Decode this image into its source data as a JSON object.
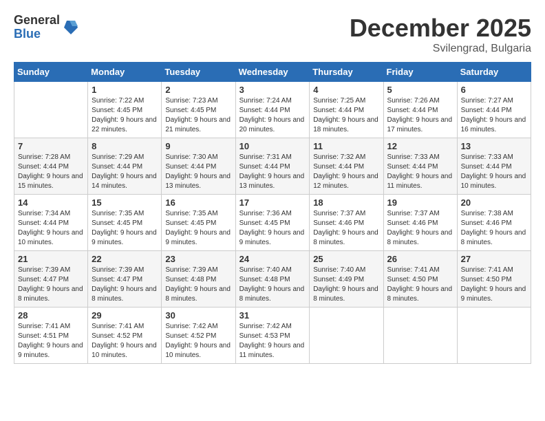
{
  "header": {
    "logo_general": "General",
    "logo_blue": "Blue",
    "month_title": "December 2025",
    "location": "Svilengrad, Bulgaria"
  },
  "days_of_week": [
    "Sunday",
    "Monday",
    "Tuesday",
    "Wednesday",
    "Thursday",
    "Friday",
    "Saturday"
  ],
  "weeks": [
    [
      {
        "day": "",
        "sunrise": "",
        "sunset": "",
        "daylight": ""
      },
      {
        "day": "1",
        "sunrise": "Sunrise: 7:22 AM",
        "sunset": "Sunset: 4:45 PM",
        "daylight": "Daylight: 9 hours and 22 minutes."
      },
      {
        "day": "2",
        "sunrise": "Sunrise: 7:23 AM",
        "sunset": "Sunset: 4:45 PM",
        "daylight": "Daylight: 9 hours and 21 minutes."
      },
      {
        "day": "3",
        "sunrise": "Sunrise: 7:24 AM",
        "sunset": "Sunset: 4:44 PM",
        "daylight": "Daylight: 9 hours and 20 minutes."
      },
      {
        "day": "4",
        "sunrise": "Sunrise: 7:25 AM",
        "sunset": "Sunset: 4:44 PM",
        "daylight": "Daylight: 9 hours and 18 minutes."
      },
      {
        "day": "5",
        "sunrise": "Sunrise: 7:26 AM",
        "sunset": "Sunset: 4:44 PM",
        "daylight": "Daylight: 9 hours and 17 minutes."
      },
      {
        "day": "6",
        "sunrise": "Sunrise: 7:27 AM",
        "sunset": "Sunset: 4:44 PM",
        "daylight": "Daylight: 9 hours and 16 minutes."
      }
    ],
    [
      {
        "day": "7",
        "sunrise": "Sunrise: 7:28 AM",
        "sunset": "Sunset: 4:44 PM",
        "daylight": "Daylight: 9 hours and 15 minutes."
      },
      {
        "day": "8",
        "sunrise": "Sunrise: 7:29 AM",
        "sunset": "Sunset: 4:44 PM",
        "daylight": "Daylight: 9 hours and 14 minutes."
      },
      {
        "day": "9",
        "sunrise": "Sunrise: 7:30 AM",
        "sunset": "Sunset: 4:44 PM",
        "daylight": "Daylight: 9 hours and 13 minutes."
      },
      {
        "day": "10",
        "sunrise": "Sunrise: 7:31 AM",
        "sunset": "Sunset: 4:44 PM",
        "daylight": "Daylight: 9 hours and 13 minutes."
      },
      {
        "day": "11",
        "sunrise": "Sunrise: 7:32 AM",
        "sunset": "Sunset: 4:44 PM",
        "daylight": "Daylight: 9 hours and 12 minutes."
      },
      {
        "day": "12",
        "sunrise": "Sunrise: 7:33 AM",
        "sunset": "Sunset: 4:44 PM",
        "daylight": "Daylight: 9 hours and 11 minutes."
      },
      {
        "day": "13",
        "sunrise": "Sunrise: 7:33 AM",
        "sunset": "Sunset: 4:44 PM",
        "daylight": "Daylight: 9 hours and 10 minutes."
      }
    ],
    [
      {
        "day": "14",
        "sunrise": "Sunrise: 7:34 AM",
        "sunset": "Sunset: 4:44 PM",
        "daylight": "Daylight: 9 hours and 10 minutes."
      },
      {
        "day": "15",
        "sunrise": "Sunrise: 7:35 AM",
        "sunset": "Sunset: 4:45 PM",
        "daylight": "Daylight: 9 hours and 9 minutes."
      },
      {
        "day": "16",
        "sunrise": "Sunrise: 7:35 AM",
        "sunset": "Sunset: 4:45 PM",
        "daylight": "Daylight: 9 hours and 9 minutes."
      },
      {
        "day": "17",
        "sunrise": "Sunrise: 7:36 AM",
        "sunset": "Sunset: 4:45 PM",
        "daylight": "Daylight: 9 hours and 9 minutes."
      },
      {
        "day": "18",
        "sunrise": "Sunrise: 7:37 AM",
        "sunset": "Sunset: 4:46 PM",
        "daylight": "Daylight: 9 hours and 8 minutes."
      },
      {
        "day": "19",
        "sunrise": "Sunrise: 7:37 AM",
        "sunset": "Sunset: 4:46 PM",
        "daylight": "Daylight: 9 hours and 8 minutes."
      },
      {
        "day": "20",
        "sunrise": "Sunrise: 7:38 AM",
        "sunset": "Sunset: 4:46 PM",
        "daylight": "Daylight: 9 hours and 8 minutes."
      }
    ],
    [
      {
        "day": "21",
        "sunrise": "Sunrise: 7:39 AM",
        "sunset": "Sunset: 4:47 PM",
        "daylight": "Daylight: 9 hours and 8 minutes."
      },
      {
        "day": "22",
        "sunrise": "Sunrise: 7:39 AM",
        "sunset": "Sunset: 4:47 PM",
        "daylight": "Daylight: 9 hours and 8 minutes."
      },
      {
        "day": "23",
        "sunrise": "Sunrise: 7:39 AM",
        "sunset": "Sunset: 4:48 PM",
        "daylight": "Daylight: 9 hours and 8 minutes."
      },
      {
        "day": "24",
        "sunrise": "Sunrise: 7:40 AM",
        "sunset": "Sunset: 4:48 PM",
        "daylight": "Daylight: 9 hours and 8 minutes."
      },
      {
        "day": "25",
        "sunrise": "Sunrise: 7:40 AM",
        "sunset": "Sunset: 4:49 PM",
        "daylight": "Daylight: 9 hours and 8 minutes."
      },
      {
        "day": "26",
        "sunrise": "Sunrise: 7:41 AM",
        "sunset": "Sunset: 4:50 PM",
        "daylight": "Daylight: 9 hours and 8 minutes."
      },
      {
        "day": "27",
        "sunrise": "Sunrise: 7:41 AM",
        "sunset": "Sunset: 4:50 PM",
        "daylight": "Daylight: 9 hours and 9 minutes."
      }
    ],
    [
      {
        "day": "28",
        "sunrise": "Sunrise: 7:41 AM",
        "sunset": "Sunset: 4:51 PM",
        "daylight": "Daylight: 9 hours and 9 minutes."
      },
      {
        "day": "29",
        "sunrise": "Sunrise: 7:41 AM",
        "sunset": "Sunset: 4:52 PM",
        "daylight": "Daylight: 9 hours and 10 minutes."
      },
      {
        "day": "30",
        "sunrise": "Sunrise: 7:42 AM",
        "sunset": "Sunset: 4:52 PM",
        "daylight": "Daylight: 9 hours and 10 minutes."
      },
      {
        "day": "31",
        "sunrise": "Sunrise: 7:42 AM",
        "sunset": "Sunset: 4:53 PM",
        "daylight": "Daylight: 9 hours and 11 minutes."
      },
      {
        "day": "",
        "sunrise": "",
        "sunset": "",
        "daylight": ""
      },
      {
        "day": "",
        "sunrise": "",
        "sunset": "",
        "daylight": ""
      },
      {
        "day": "",
        "sunrise": "",
        "sunset": "",
        "daylight": ""
      }
    ]
  ]
}
